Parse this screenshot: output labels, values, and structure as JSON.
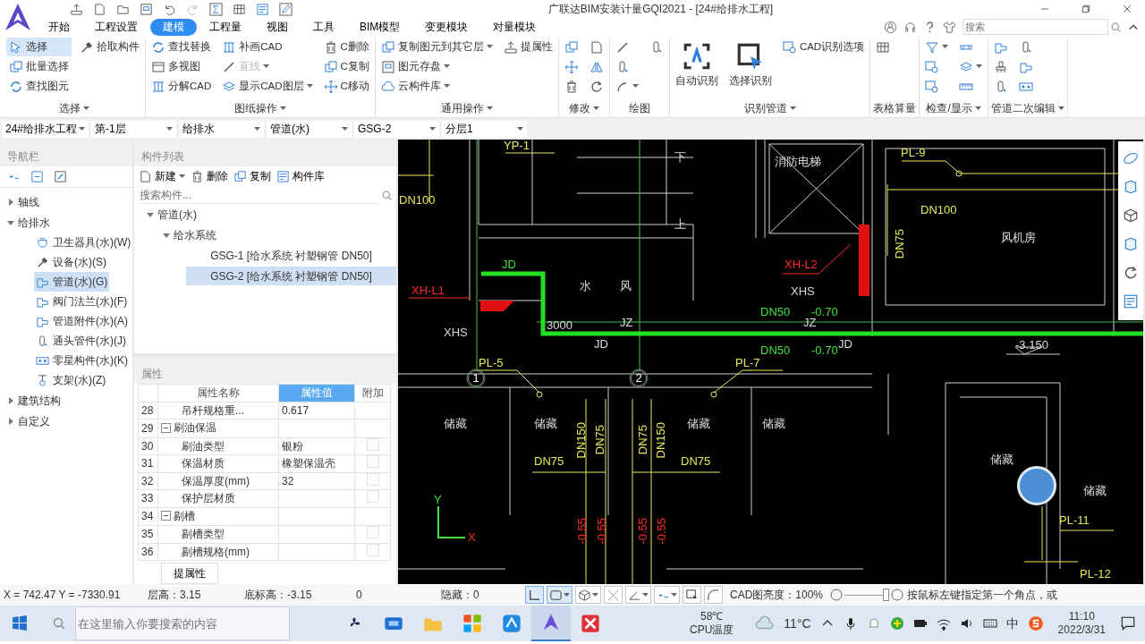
{
  "title_bar": {
    "title": "广联达BIM安装计量GQI2021 - [24#给排水工程]",
    "search_placeholder": "搜索"
  },
  "ribbon_tabs": [
    {
      "label": "开始",
      "selected": false
    },
    {
      "label": "工程设置",
      "selected": false
    },
    {
      "label": "建模",
      "selected": true
    },
    {
      "label": "工程量",
      "selected": false
    },
    {
      "label": "视图",
      "selected": false
    },
    {
      "label": "工具",
      "selected": false
    },
    {
      "label": "BIM模型",
      "selected": false
    },
    {
      "label": "变更模块",
      "selected": false
    },
    {
      "label": "对量模块",
      "selected": false
    }
  ],
  "ribbon_groups": [
    {
      "label": "选择",
      "dropdown": true,
      "columns": [
        [
          {
            "kind": "small",
            "label": "选择",
            "selected": true,
            "disabled": false,
            "dropdown": false
          },
          {
            "kind": "small",
            "label": "批量选择",
            "selected": false,
            "disabled": false,
            "dropdown": false
          },
          {
            "kind": "small",
            "label": "查找图元",
            "selected": false,
            "disabled": false,
            "dropdown": false
          }
        ],
        [
          {
            "kind": "small",
            "label": "拾取构件",
            "selected": false,
            "disabled": false,
            "dropdown": false
          }
        ]
      ]
    },
    {
      "label": "图纸操作",
      "dropdown": true,
      "columns": [
        [
          {
            "kind": "small",
            "label": "查找替换",
            "selected": false,
            "disabled": false,
            "dropdown": false
          },
          {
            "kind": "small",
            "label": "多视图",
            "selected": false,
            "disabled": false,
            "dropdown": false
          },
          {
            "kind": "small",
            "label": "分解CAD",
            "selected": false,
            "disabled": false,
            "dropdown": false
          }
        ],
        [
          {
            "kind": "small",
            "label": "补画CAD",
            "selected": false,
            "disabled": false,
            "dropdown": false
          },
          {
            "kind": "small",
            "label": "直线",
            "selected": false,
            "disabled": true,
            "dropdown": true
          },
          {
            "kind": "small",
            "label": "显示CAD图层",
            "selected": false,
            "disabled": false,
            "dropdown": true
          }
        ],
        [
          {
            "kind": "small",
            "label": "C删除",
            "selected": false,
            "disabled": false,
            "dropdown": false
          },
          {
            "kind": "small",
            "label": "C复制",
            "selected": false,
            "disabled": false,
            "dropdown": false
          },
          {
            "kind": "small",
            "label": "C移动",
            "selected": false,
            "disabled": false,
            "dropdown": false
          }
        ]
      ]
    },
    {
      "label": "通用操作",
      "dropdown": true,
      "columns": [
        [
          {
            "kind": "small",
            "label": "复制图元到其它层",
            "selected": false,
            "disabled": false,
            "dropdown": true
          },
          {
            "kind": "small",
            "label": "图元存盘",
            "selected": false,
            "disabled": false,
            "dropdown": true
          },
          {
            "kind": "small",
            "label": "云构件库",
            "selected": false,
            "disabled": false,
            "dropdown": true
          }
        ],
        [
          {
            "kind": "small",
            "label": "提属性",
            "selected": false,
            "disabled": false,
            "dropdown": false
          }
        ]
      ]
    },
    {
      "label": "修改",
      "dropdown": true,
      "columns": [
        [
          {
            "kind": "icon",
            "dropdown": false
          },
          {
            "kind": "icon",
            "dropdown": false
          },
          {
            "kind": "icon",
            "dropdown": false
          }
        ],
        [
          {
            "kind": "icon",
            "dropdown": false
          },
          {
            "kind": "icon",
            "dropdown": false
          },
          {
            "kind": "icon",
            "dropdown": false
          }
        ]
      ]
    },
    {
      "label": "绘图",
      "dropdown": false,
      "columns": [
        [
          {
            "kind": "icon",
            "dropdown": false
          },
          {
            "kind": "icon",
            "dropdown": false
          },
          {
            "kind": "icon",
            "dropdown": true
          }
        ],
        [
          {
            "kind": "icon",
            "dropdown": false
          }
        ]
      ]
    },
    {
      "label": "识别管道",
      "dropdown": true,
      "columns": [
        [
          {
            "kind": "large",
            "label": "自动识别",
            "selected": false,
            "disabled": false,
            "dropdown": false
          }
        ],
        [
          {
            "kind": "large",
            "label": "选择识别",
            "selected": false,
            "disabled": false,
            "dropdown": false
          }
        ],
        [
          {
            "kind": "small",
            "label": "CAD识别选项",
            "selected": false,
            "disabled": false,
            "dropdown": false
          }
        ]
      ]
    },
    {
      "label": "表格算量",
      "dropdown": false,
      "columns": [
        [
          {
            "kind": "icon",
            "dropdown": false
          }
        ]
      ]
    },
    {
      "label": "检查/显示",
      "dropdown": true,
      "columns": [
        [
          {
            "kind": "icon",
            "dropdown": true
          },
          {
            "kind": "icon",
            "dropdown": false
          },
          {
            "kind": "icon",
            "dropdown": false
          }
        ],
        [
          {
            "kind": "icon",
            "dropdown": false
          },
          {
            "kind": "icon",
            "dropdown": true
          },
          {
            "kind": "icon",
            "dropdown": false
          }
        ]
      ]
    },
    {
      "label": "管道二次编辑",
      "dropdown": true,
      "columns": [
        [
          {
            "kind": "icon",
            "dropdown": false
          },
          {
            "kind": "icon",
            "dropdown": false
          },
          {
            "kind": "icon",
            "dropdown": false
          }
        ],
        [
          {
            "kind": "icon",
            "dropdown": false
          },
          {
            "kind": "icon",
            "dropdown": false
          },
          {
            "kind": "icon",
            "dropdown": false
          }
        ]
      ]
    }
  ],
  "selectors": [
    {
      "value": "24#给排水工程"
    },
    {
      "value": "第-1层"
    },
    {
      "value": "给排水"
    },
    {
      "value": "管道(水)"
    },
    {
      "value": "GSG-2"
    },
    {
      "value": "分层1"
    }
  ],
  "navigation": {
    "title": "导航栏",
    "tree": [
      {
        "label": "轴线",
        "expanded": false
      },
      {
        "label": "给排水",
        "expanded": true,
        "children": [
          {
            "label": "卫生器具(水)(W)",
            "selected": false
          },
          {
            "label": "设备(水)(S)",
            "selected": false
          },
          {
            "label": "管道(水)(G)",
            "selected": true
          },
          {
            "label": "阀门法兰(水)(F)",
            "selected": false
          },
          {
            "label": "管道附件(水)(A)",
            "selected": false
          },
          {
            "label": "通头管件(水)(J)",
            "selected": false
          },
          {
            "label": "零星构件(水)(K)",
            "selected": false
          },
          {
            "label": "支架(水)(Z)",
            "selected": false
          }
        ]
      },
      {
        "label": "建筑结构",
        "expanded": false
      },
      {
        "label": "自定义",
        "expanded": false
      }
    ]
  },
  "component_list": {
    "title": "构件列表",
    "toolbar": [
      {
        "label": "新建",
        "dropdown": true
      },
      {
        "label": "删除",
        "dropdown": false
      },
      {
        "label": "复制",
        "dropdown": false
      },
      {
        "label": "构件库",
        "dropdown": false
      }
    ],
    "search_placeholder": "搜索构件...",
    "tree": [
      {
        "label": "管道(水)",
        "expanded": true,
        "children": [
          {
            "label": "给水系统",
            "expanded": true,
            "children": [
              {
                "label": "GSG-1 [给水系统 衬塑钢管 DN50]",
                "selected": false
              },
              {
                "label": "GSG-2 [给水系统 衬塑钢管 DN50]",
                "selected": true
              }
            ]
          }
        ]
      }
    ]
  },
  "properties": {
    "title": "属性",
    "columns": [
      "属性名称",
      "属性值",
      "附加"
    ],
    "rows": [
      {
        "kind": "property",
        "number": "28",
        "name": "吊杆规格重...",
        "value": "0.617"
      },
      {
        "kind": "group",
        "number": "29",
        "name": "刷油保温",
        "expanded": true
      },
      {
        "kind": "property_check",
        "number": "30",
        "name": "刷油类型",
        "value": "银粉",
        "checked": false
      },
      {
        "kind": "property_check",
        "number": "31",
        "name": "保温材质",
        "value": "橡塑保温壳",
        "checked": false
      },
      {
        "kind": "property_check",
        "number": "32",
        "name": "保温厚度(mm)",
        "value": "32",
        "checked": false
      },
      {
        "kind": "property_check",
        "number": "33",
        "name": "保护层材质",
        "value": "",
        "checked": false
      },
      {
        "kind": "group",
        "number": "34",
        "name": "剔槽",
        "expanded": true
      },
      {
        "kind": "property_check",
        "number": "35",
        "name": "剔槽类型",
        "value": "",
        "checked": false
      },
      {
        "kind": "property_check",
        "number": "36",
        "name": "剔槽规格(mm)",
        "value": "",
        "checked": false
      }
    ],
    "button": "提属性"
  },
  "drawing": {
    "labels": [
      {
        "text": "YP-1",
        "kind": "drain",
        "vertical": false
      },
      {
        "text": "DN100",
        "kind": "drain",
        "vertical": false
      },
      {
        "text": "下",
        "kind": "plan",
        "vertical": false
      },
      {
        "text": "消防电梯",
        "kind": "plan",
        "vertical": false
      },
      {
        "text": "PL-9",
        "kind": "drain",
        "vertical": false
      },
      {
        "text": "DN100",
        "kind": "drain",
        "vertical": false
      },
      {
        "text": "DN75",
        "kind": "drain",
        "vertical": true
      },
      {
        "text": "上",
        "kind": "plan",
        "vertical": false
      },
      {
        "text": "风机房",
        "kind": "plan",
        "vertical": false
      },
      {
        "text": "XH-L2",
        "kind": "fire",
        "vertical": false
      },
      {
        "text": "JD",
        "kind": "supply",
        "vertical": false
      },
      {
        "text": "XH-L1",
        "kind": "fire",
        "vertical": false
      },
      {
        "text": "水",
        "kind": "plan",
        "vertical": false
      },
      {
        "text": "风",
        "kind": "plan",
        "vertical": false
      },
      {
        "text": "XHS",
        "kind": "plan",
        "vertical": false
      },
      {
        "text": "DN50",
        "kind": "supply",
        "vertical": false
      },
      {
        "text": "-0.70",
        "kind": "supply",
        "vertical": false
      },
      {
        "text": "3000",
        "kind": "plan",
        "vertical": false
      },
      {
        "text": "JZ",
        "kind": "plan",
        "vertical": false
      },
      {
        "text": "JZ",
        "kind": "plan",
        "vertical": false
      },
      {
        "text": "XHS",
        "kind": "plan",
        "vertical": false
      },
      {
        "text": "JD",
        "kind": "plan",
        "vertical": false
      },
      {
        "text": "JD",
        "kind": "plan",
        "vertical": false
      },
      {
        "text": "DN50",
        "kind": "supply",
        "vertical": false
      },
      {
        "text": "-0.70",
        "kind": "supply",
        "vertical": false
      },
      {
        "text": "-3.150",
        "kind": "plan",
        "vertical": false
      },
      {
        "text": "PL-5",
        "kind": "drain",
        "vertical": false
      },
      {
        "text": "PL-7",
        "kind": "drain",
        "vertical": false
      },
      {
        "text": "1",
        "kind": "axis",
        "vertical": false
      },
      {
        "text": "2",
        "kind": "axis",
        "vertical": false
      },
      {
        "text": "储藏",
        "kind": "plan",
        "vertical": false
      },
      {
        "text": "储藏",
        "kind": "plan",
        "vertical": false
      },
      {
        "text": "储藏",
        "kind": "plan",
        "vertical": false
      },
      {
        "text": "储藏",
        "kind": "plan",
        "vertical": false
      },
      {
        "text": "储藏",
        "kind": "plan",
        "vertical": false
      },
      {
        "text": "储藏",
        "kind": "plan",
        "vertical": false
      },
      {
        "text": "DN150",
        "kind": "drain",
        "vertical": true
      },
      {
        "text": "DN75",
        "kind": "drain",
        "vertical": true
      },
      {
        "text": "DN75",
        "kind": "drain",
        "vertical": true
      },
      {
        "text": "DN150",
        "kind": "drain",
        "vertical": true
      },
      {
        "text": "DN75",
        "kind": "drain",
        "vertical": false
      },
      {
        "text": "DN75",
        "kind": "drain",
        "vertical": false
      },
      {
        "text": "-0.55",
        "kind": "fire",
        "vertical": true
      },
      {
        "text": "-0.55",
        "kind": "fire",
        "vertical": true
      },
      {
        "text": "-0.55",
        "kind": "fire",
        "vertical": true
      },
      {
        "text": "-0.55",
        "kind": "fire",
        "vertical": true
      },
      {
        "text": "PL-11",
        "kind": "drain",
        "vertical": false
      },
      {
        "text": "PL-12",
        "kind": "drain",
        "vertical": false
      },
      {
        "text": "Y",
        "kind": "supply",
        "vertical": false
      },
      {
        "text": "X",
        "kind": "fire",
        "vertical": false
      }
    ]
  },
  "status_bar": {
    "coordinates": "X = 742.47 Y = -7330.91",
    "floor_height": "层高：3.15",
    "base_elevation": "底标高：-3.15",
    "count": "0",
    "hidden": "隐藏：0",
    "tools": [
      {
        "selected": true,
        "dropdown": false
      },
      {
        "selected": true,
        "dropdown": true
      },
      {
        "selected": false,
        "dropdown": true
      },
      {
        "selected": false,
        "dropdown": false
      },
      {
        "selected": false,
        "dropdown": true
      },
      {
        "selected": false,
        "dropdown": true
      },
      {
        "selected": false,
        "dropdown": false
      },
      {
        "selected": false,
        "dropdown": false
      }
    ],
    "brightness_label": "CAD图亮度：100%",
    "brightness": {
      "level": 1
    },
    "prompt": "按鼠标左键指定第一个角点，或"
  },
  "taskbar": {
    "search_placeholder": "在这里输入你要搜索的内容",
    "apps": [
      {
        "selected": false
      },
      {
        "selected": false
      },
      {
        "selected": false
      },
      {
        "selected": false
      },
      {
        "selected": false
      },
      {
        "selected": true
      },
      {
        "selected": false
      }
    ],
    "temperature": "58℃",
    "temperature_label": "CPU温度",
    "weather": "11°C",
    "ime": "中",
    "time": "11:10",
    "date": "2022/3/31"
  }
}
